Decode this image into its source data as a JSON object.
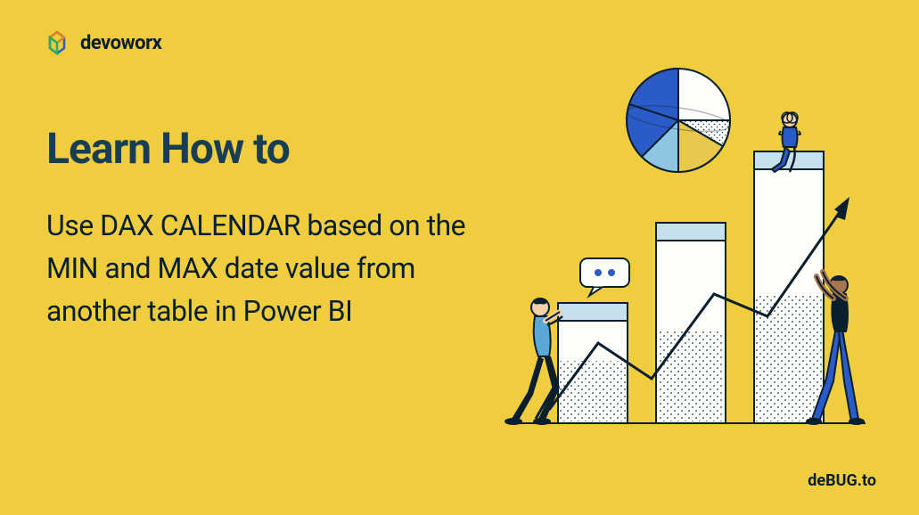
{
  "logo": {
    "text": "devoworx"
  },
  "heading": "Learn How to",
  "subheading": "Use DAX CALENDAR based on the MIN and MAX date value from another table in Power BI",
  "footer": "deBUG.to"
}
